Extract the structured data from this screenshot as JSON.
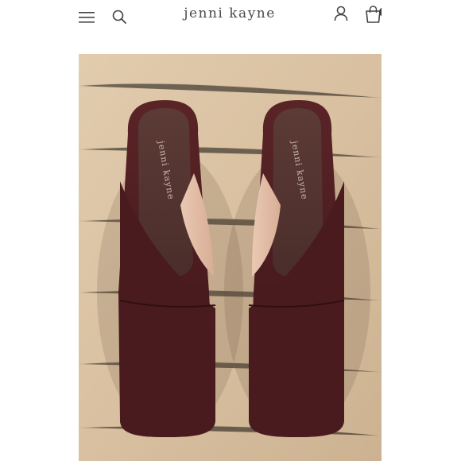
{
  "header": {
    "brand": "jenni kayne",
    "menu_icon": "hamburger-menu-icon",
    "search_icon": "search-icon",
    "account_icon": "user-icon",
    "bag_icon": "shopping-bag-icon"
  },
  "product": {
    "insole_branding": "jenni kayne",
    "image_subject": "burgundy leather square-toe mules on wooden surface"
  },
  "colors": {
    "leather": "#4a1d1f",
    "floor": "#d9c2a4",
    "brand_text": "#4a4a4a"
  }
}
